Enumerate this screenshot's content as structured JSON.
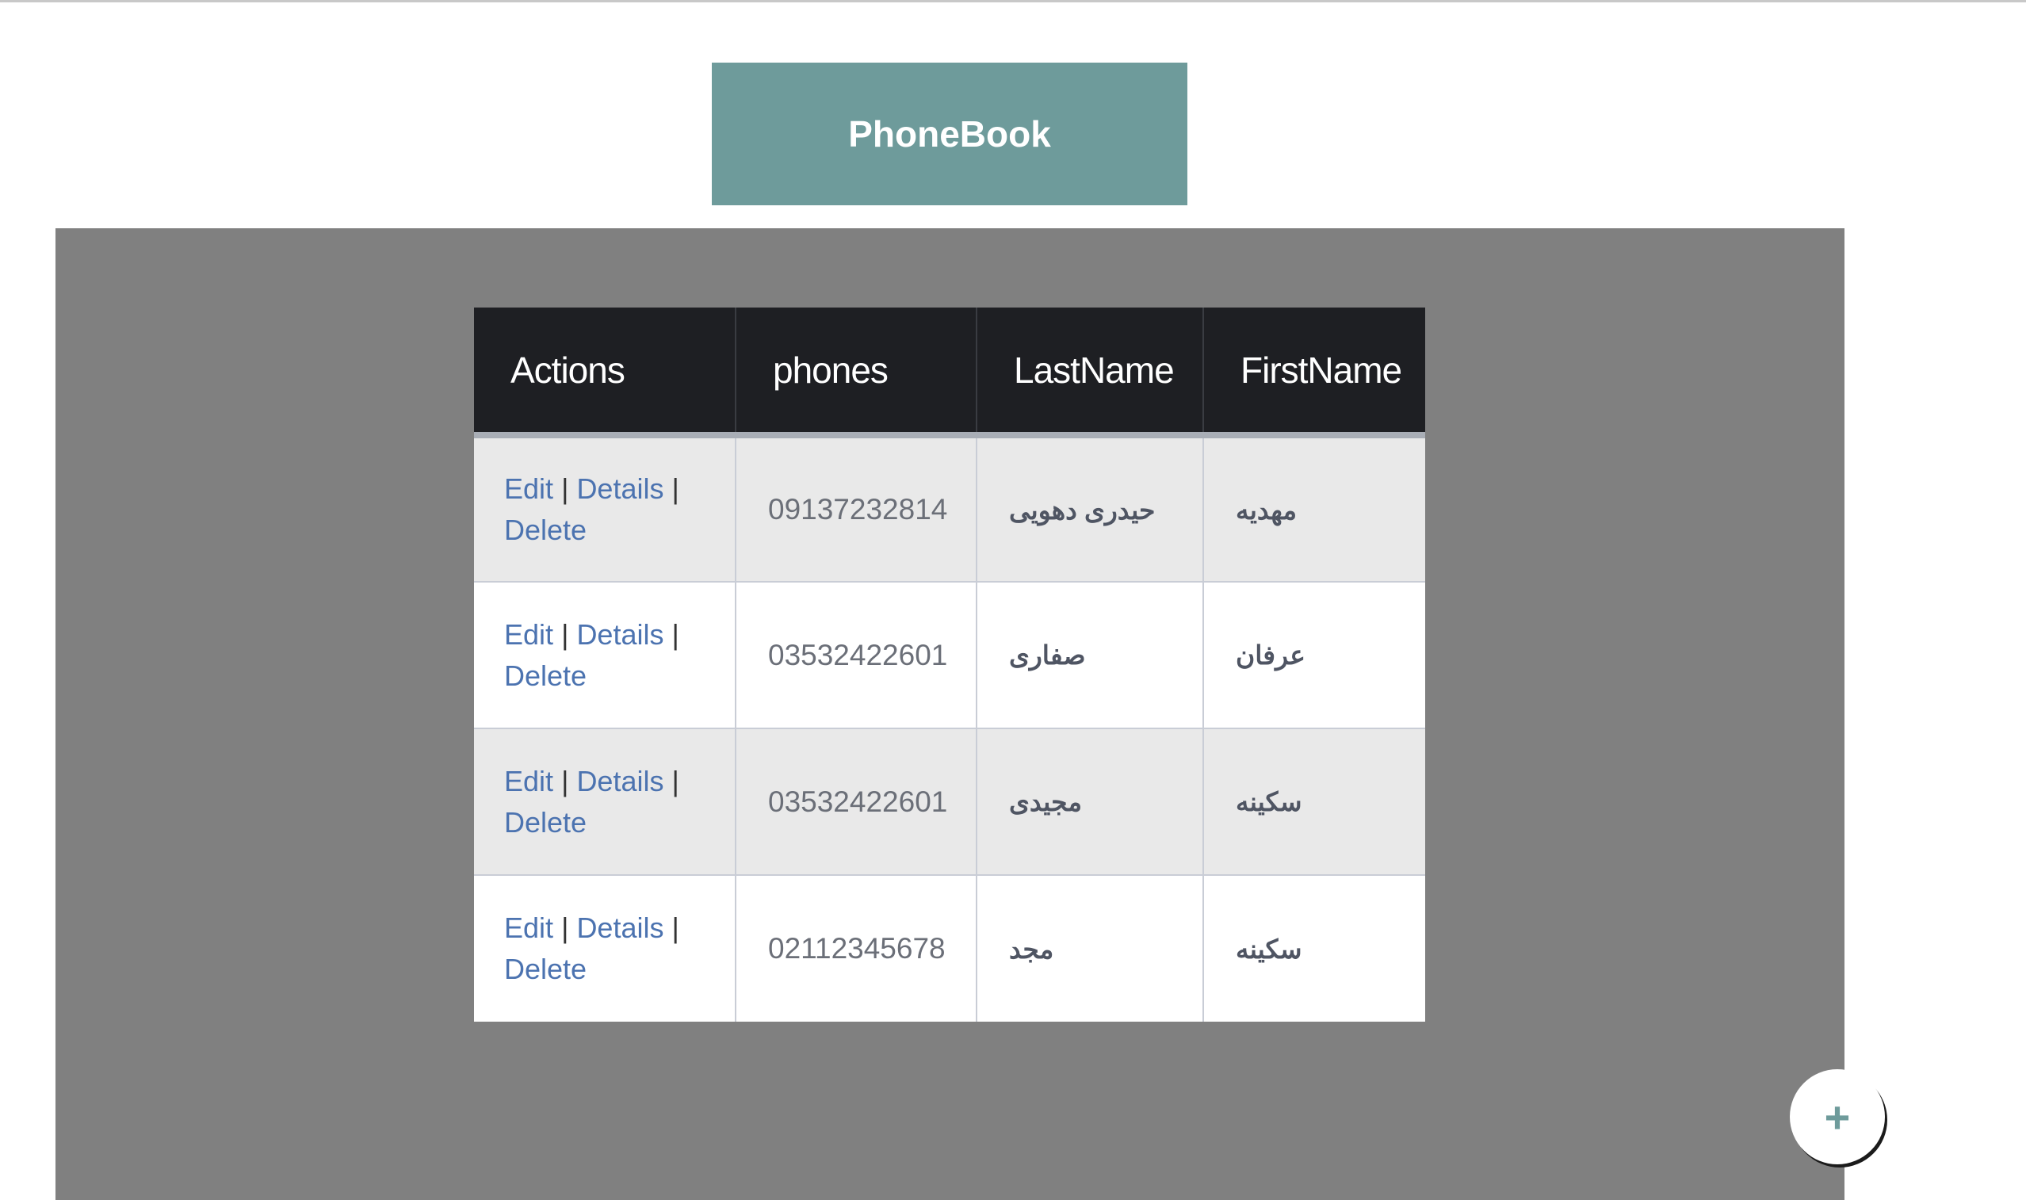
{
  "header": {
    "title": "PhoneBook"
  },
  "table": {
    "columns": [
      "Actions",
      "phones",
      "LastName",
      "FirstName"
    ],
    "rows": [
      {
        "phone": "09137232814",
        "last_name": "حیدری دهویی",
        "first_name": "مهدیه"
      },
      {
        "phone": "03532422601",
        "last_name": "صفاری",
        "first_name": "عرفان"
      },
      {
        "phone": "03532422601",
        "last_name": "مجیدی",
        "first_name": "سکینه"
      },
      {
        "phone": "02112345678",
        "last_name": "مجد",
        "first_name": "سکینه"
      }
    ],
    "actions": {
      "edit": "Edit",
      "details": "Details",
      "delete": "Delete",
      "separator": "|"
    }
  },
  "fab": {
    "label": "+"
  },
  "colors": {
    "accent": "#6e9b9b",
    "panel": "#808080",
    "table_header": "#1e1f23",
    "link": "#4c73b0"
  }
}
